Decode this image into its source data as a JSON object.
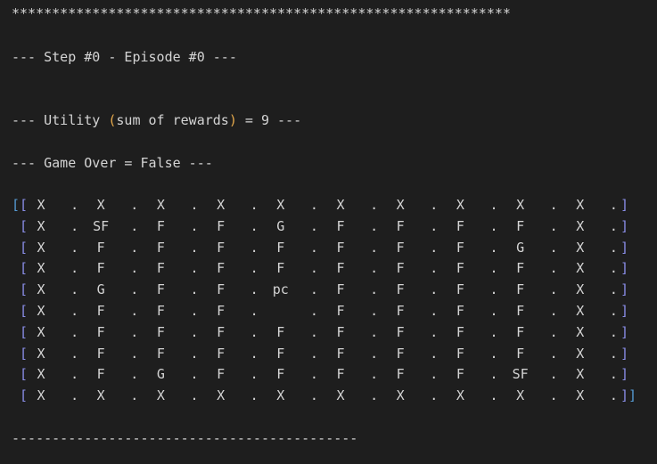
{
  "header_stars": "**************************************************************",
  "step_line": "--- Step #0 - Episode #0 ---",
  "utility": {
    "prefix": "--- Utility ",
    "open_paren": "(",
    "middle": "sum of rewards",
    "close_paren": ")",
    "suffix": " = 9 ---"
  },
  "game_over_line": "--- Game Over = False ---",
  "grid": [
    [
      "X",
      "X",
      "X",
      "X",
      "X",
      "X",
      "X",
      "X",
      "X",
      "X"
    ],
    [
      "X",
      "SF",
      "F",
      "F",
      "G",
      "F",
      "F",
      "F",
      "F",
      "X"
    ],
    [
      "X",
      "F",
      "F",
      "F",
      "F",
      "F",
      "F",
      "F",
      "G",
      "X"
    ],
    [
      "X",
      "F",
      "F",
      "F",
      "F",
      "F",
      "F",
      "F",
      "F",
      "X"
    ],
    [
      "X",
      "G",
      "F",
      "F",
      "pc",
      "F",
      "F",
      "F",
      "F",
      "X"
    ],
    [
      "X",
      "F",
      "F",
      "F",
      "",
      "F",
      "F",
      "F",
      "F",
      "X"
    ],
    [
      "X",
      "F",
      "F",
      "F",
      "F",
      "F",
      "F",
      "F",
      "F",
      "X"
    ],
    [
      "X",
      "F",
      "F",
      "F",
      "F",
      "F",
      "F",
      "F",
      "F",
      "X"
    ],
    [
      "X",
      "F",
      "G",
      "F",
      "F",
      "F",
      "F",
      "F",
      "SF",
      "X"
    ],
    [
      "X",
      "X",
      "X",
      "X",
      "X",
      "X",
      "X",
      "X",
      "X",
      "X"
    ]
  ],
  "footer_dashes": "-------------------------------------------"
}
